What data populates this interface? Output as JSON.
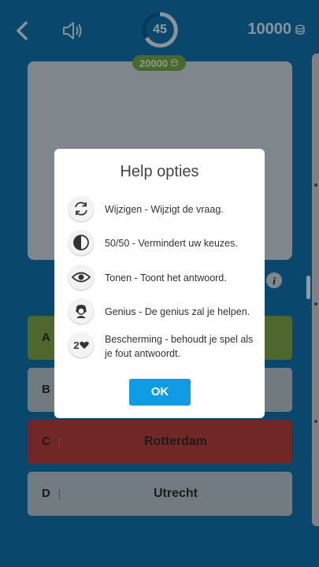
{
  "header": {
    "timer_value": "45",
    "prize_value": "20000",
    "coins_value": "10000"
  },
  "answers": [
    {
      "letter": "A",
      "text": ""
    },
    {
      "letter": "B",
      "text": ""
    },
    {
      "letter": "C",
      "text": "Rotterdam"
    },
    {
      "letter": "D",
      "text": "Utrecht"
    }
  ],
  "dialog": {
    "title": "Help opties",
    "options": [
      {
        "icon": "refresh-icon",
        "label": "Wijzigen - Wijzigt de vraag."
      },
      {
        "icon": "half-circle-icon",
        "label": "50/50 - Vermindert uw keuzes."
      },
      {
        "icon": "eye-icon",
        "label": "Tonen - Toont het antwoord."
      },
      {
        "icon": "genius-icon",
        "label": "Genius - De genius zal je helpen."
      },
      {
        "icon": "heart-icon",
        "label": "Bescherming - behoudt je spel als je fout antwoordt.",
        "icon_text": "2"
      }
    ],
    "ok_label": "OK"
  },
  "colors": {
    "background": "#0f6fa7",
    "correct": "#7a9d45",
    "wrong": "#ad3d3a",
    "ok_button": "#0f9ce4"
  }
}
